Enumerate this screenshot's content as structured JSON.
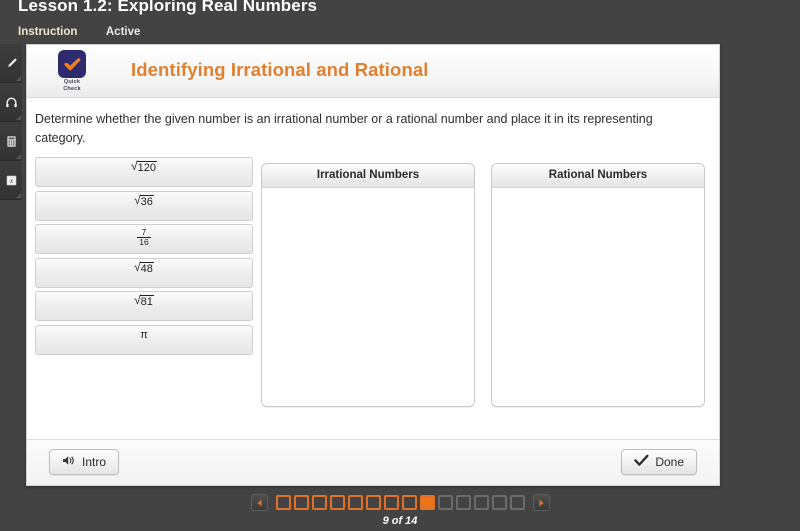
{
  "header": {
    "lesson_title": "Lesson 1.2: Exploring Real Numbers",
    "tabs": [
      {
        "label": "Instruction",
        "state": "active"
      },
      {
        "label": "Active",
        "state": "inactive"
      }
    ]
  },
  "toolrail": {
    "items": [
      {
        "name": "highlighter-icon",
        "label": "Highlighter"
      },
      {
        "name": "headphones-icon",
        "label": "Audio"
      },
      {
        "name": "calculator-icon",
        "label": "Calculator"
      },
      {
        "name": "formula-icon",
        "label": "Formula Reference"
      }
    ]
  },
  "activity": {
    "badge_line1": "Quick",
    "badge_line2": "Check",
    "title": "Identifying Irrational and Rational",
    "instruction": "Determine whether the given number is an irrational number or a rational number and place it in its representing category.",
    "accent_color": "#e08030",
    "badge_color": "#2e2a6e"
  },
  "tiles": [
    {
      "id": "tile-sqrt120",
      "kind": "radical",
      "radicand": "120",
      "text": "√120"
    },
    {
      "id": "tile-sqrt36",
      "kind": "radical",
      "radicand": "36",
      "text": "√36"
    },
    {
      "id": "tile-frac",
      "kind": "fraction",
      "numerator": "7",
      "denominator": "16",
      "text": "7/16"
    },
    {
      "id": "tile-sqrt48",
      "kind": "radical",
      "radicand": "48",
      "text": "√48"
    },
    {
      "id": "tile-sqrt81",
      "kind": "radical",
      "radicand": "81",
      "text": "√81"
    },
    {
      "id": "tile-pi",
      "kind": "symbol",
      "text": "π"
    }
  ],
  "zones": [
    {
      "id": "zone-irrational",
      "title": "Irrational Numbers",
      "items": []
    },
    {
      "id": "zone-rational",
      "title": "Rational Numbers",
      "items": []
    }
  ],
  "footer": {
    "intro_label": "Intro",
    "done_label": "Done"
  },
  "pager": {
    "total": 14,
    "current": 9,
    "count_label": "9 of 14",
    "prev_glyph": "◀",
    "next_glyph": "▶",
    "visited_color": "#e0702a",
    "current_color": "#ed7519",
    "future_color": "#6b6b6b"
  }
}
